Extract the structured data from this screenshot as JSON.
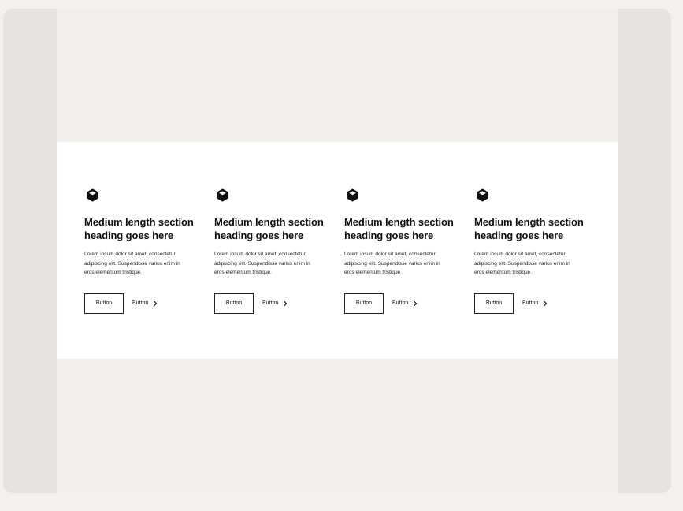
{
  "section": {
    "cards": [
      {
        "icon": "cube-icon",
        "heading": "Medium length section heading goes here",
        "text": "Lorem ipsum dolor sit amet, consectetur\nadipiscing elit. Suspendisse varius enim in\neros elementum tristique.",
        "primary_button": "Button",
        "link_button": "Button"
      },
      {
        "icon": "cube-icon",
        "heading": "Medium length section heading goes here",
        "text": "Lorem ipsum dolor sit amet, consectetur\nadipiscing elit. Suspendisse varius enim in\neros elementum tristique.",
        "primary_button": "Button",
        "link_button": "Button"
      },
      {
        "icon": "cube-icon",
        "heading": "Medium length section heading goes here",
        "text": "Lorem ipsum dolor sit amet, consectetur\nadipiscing elit. Suspendisse varius enim in\neros elementum tristique.",
        "primary_button": "Button",
        "link_button": "Button"
      },
      {
        "icon": "cube-icon",
        "heading": "Medium length section heading goes here",
        "text": "Lorem ipsum dolor sit amet, consectetur\nadipiscing elit. Suspendisse varius enim in\neros elementum tristique.",
        "primary_button": "Button",
        "link_button": "Button"
      }
    ]
  },
  "colors": {
    "page_bg": "#f2f1ee",
    "outer_panel": "#e4e3df",
    "canvas": "#f1f0ee",
    "section_bg": "#ffffff",
    "text": "#111111"
  }
}
